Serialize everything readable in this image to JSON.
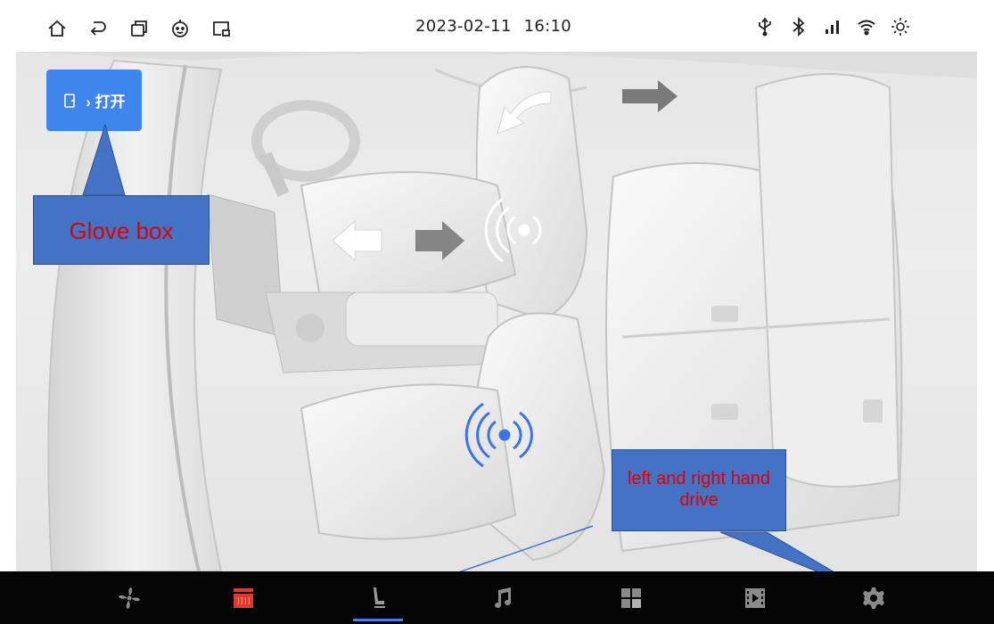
{
  "status_bar": {
    "date": "2023-02-11",
    "time": "16:10",
    "left_icons": [
      "home-icon",
      "back-icon",
      "recent-apps-icon",
      "assistant-icon",
      "screen-cast-icon"
    ],
    "right_icons": [
      "usb-icon",
      "bluetooth-icon",
      "signal-icon",
      "wifi-icon",
      "brightness-icon"
    ]
  },
  "glove_box_button": {
    "icon": "glove-box-open-icon",
    "label": "› 打开"
  },
  "callouts": {
    "glove_box": "Glove box",
    "drive": "left and right hand drive"
  },
  "nav": {
    "items": [
      {
        "icon": "fan-icon"
      },
      {
        "icon": "heater-icon",
        "color": "#e0382a"
      },
      {
        "icon": "seat-icon",
        "active": true
      },
      {
        "icon": "music-icon"
      },
      {
        "icon": "apps-grid-icon"
      },
      {
        "icon": "video-icon"
      },
      {
        "icon": "settings-icon"
      }
    ],
    "accent": "#4a7fdc"
  },
  "colors": {
    "button_blue": "#3f85ee",
    "callout_blue": "#4472c4",
    "callout_text": "#e00000",
    "seat_vibration_blue": "#3a74e8"
  }
}
